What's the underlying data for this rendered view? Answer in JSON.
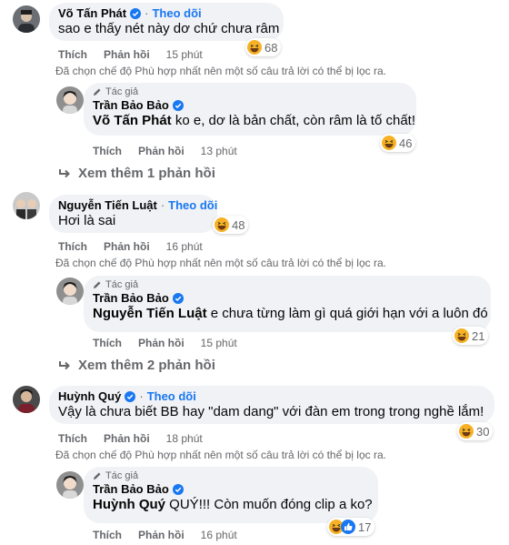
{
  "comments": [
    {
      "author": "Võ Tấn Phát",
      "follow": "Theo dõi",
      "text": "sao e thấy nét này dơ chứ chưa râm",
      "reactions": "68",
      "like": "Thích",
      "reply": "Phản hồi",
      "time": "15 phút",
      "note": "Đã chọn chế độ Phù hợp nhất nên một số câu trả lời có thể bị lọc ra.",
      "reply_comment": {
        "badge": "Tác giả",
        "author": "Trần Bảo Bảo",
        "mention": "Võ Tấn Phát",
        "text": " ko e, dơ là bản chất, còn râm là tố chất!",
        "reactions": "46",
        "like": "Thích",
        "reply": "Phản hồi",
        "time": "13 phút"
      },
      "more": "Xem thêm 1 phản hồi"
    },
    {
      "author": "Nguyễn Tiến Luật",
      "follow": "Theo dõi",
      "text": "Hơi là sai",
      "reactions": "48",
      "like": "Thích",
      "reply": "Phản hồi",
      "time": "16 phút",
      "note": "Đã chọn chế độ Phù hợp nhất nên một số câu trả lời có thể bị lọc ra.",
      "reply_comment": {
        "badge": "Tác giả",
        "author": "Trần Bảo Bảo",
        "mention": "Nguyễn Tiến Luật",
        "text": " e chưa từng làm gì quá giới hạn với a luôn đó",
        "reactions": "21",
        "like": "Thích",
        "reply": "Phản hồi",
        "time": "15 phút"
      },
      "more": "Xem thêm 2 phản hồi"
    },
    {
      "author": "Huỳnh Quý",
      "follow": "Theo dõi",
      "text": "Vậy là chưa biết BB hay \"dam dang\" với đàn em trong trong nghề lắm!",
      "reactions": "30",
      "like": "Thích",
      "reply": "Phản hồi",
      "time": "18 phút",
      "note": "Đã chọn chế độ Phù hợp nhất nên một số câu trả lời có thể bị lọc ra.",
      "reply_comment": {
        "badge": "Tác giả",
        "author": "Trần Bảo Bảo",
        "mention": "Huỳnh Quý",
        "text": " QUÝ!!! Còn muốn đóng clip a ko?",
        "reactions": "17",
        "like": "Thích",
        "reply": "Phản hồi",
        "time": "16 phút"
      }
    }
  ],
  "colors": {
    "link": "#1877f2",
    "bubble": "#f0f2f5",
    "muted": "#65676b",
    "haha": "#f7b125"
  },
  "icons": {
    "haha": "haha-emoji-icon",
    "like": "like-emoji-icon",
    "verified": "verified-badge-icon",
    "reply_arrow": "reply-arrow-icon",
    "author": "pencil-icon"
  }
}
